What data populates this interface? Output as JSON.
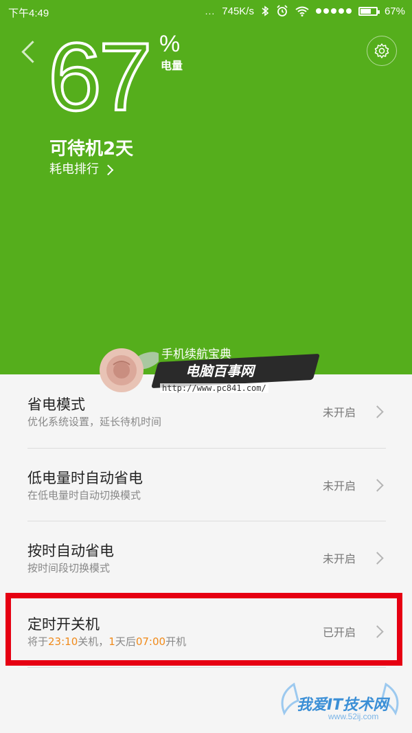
{
  "status_bar": {
    "time": "下午4:49",
    "dots": "...",
    "network_speed": "745K/s",
    "battery_percent": "67%",
    "battery_level": 0.67
  },
  "header": {
    "battery_value": "67",
    "percent_sign": "%",
    "unit_label": "电量",
    "standby_text": "可待机2天",
    "ranking_link": "耗电排行"
  },
  "watermark": {
    "line1": "手机续航宝典",
    "line2": "电脑百事网",
    "url": "http://www.pc841.com/"
  },
  "settings": [
    {
      "title": "省电模式",
      "subtitle": "优化系统设置，延长待机时间",
      "status": "未开启"
    },
    {
      "title": "低电量时自动省电",
      "subtitle": "在低电量时自动切换模式",
      "status": "未开启"
    },
    {
      "title": "按时自动省电",
      "subtitle": "按时间段切换模式",
      "status": "未开启"
    },
    {
      "title": "定时开关机",
      "subtitle_parts": {
        "p1": "将于",
        "t1": "23:10",
        "p2": "关机，",
        "n": "1",
        "p3": "天后",
        "t2": "07:00",
        "p4": "开机"
      },
      "status": "已开启"
    }
  ],
  "site_logo": {
    "text": "我爱IT技术网",
    "url": "www.52ij.com"
  },
  "colors": {
    "header_bg": "#55ae1c",
    "highlight_box": "#e60012",
    "time_accent": "#f08a1a"
  }
}
